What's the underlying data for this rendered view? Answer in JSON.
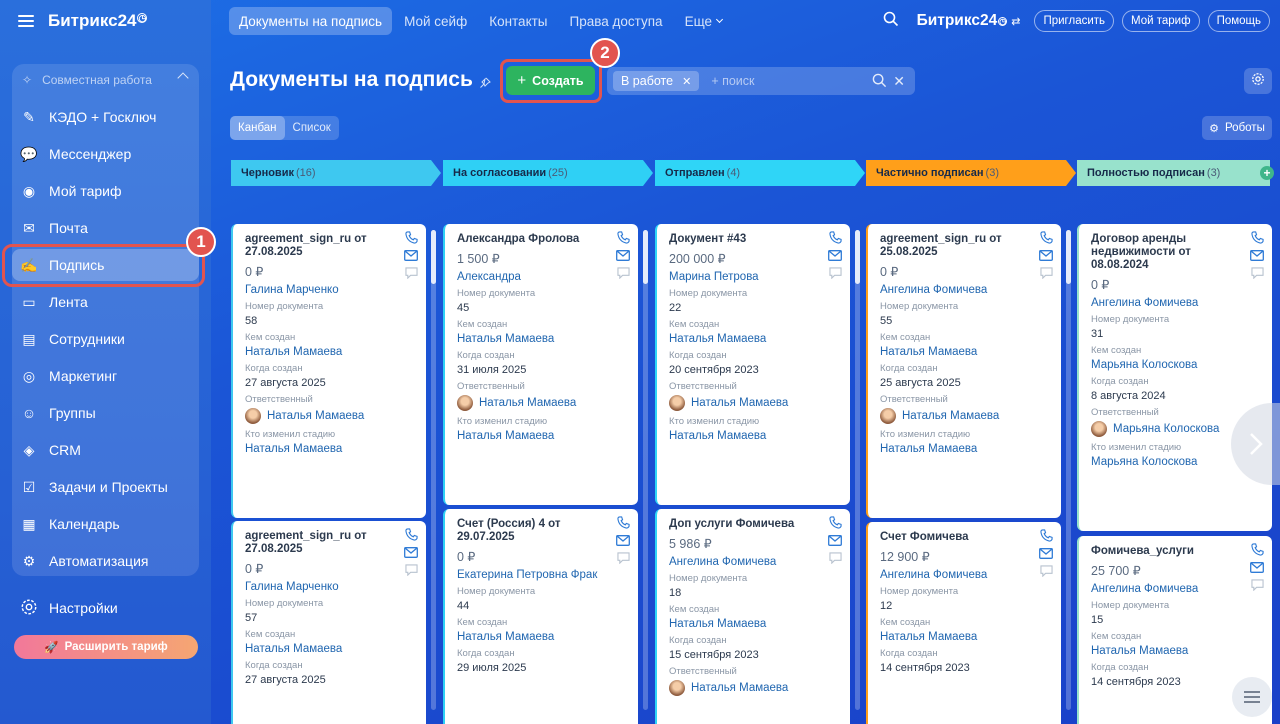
{
  "header": {
    "brand": "Битрикс24",
    "tabs": [
      {
        "label": "Документы на подпись",
        "active": true
      },
      {
        "label": "Мой сейф"
      },
      {
        "label": "Контакты"
      },
      {
        "label": "Права доступа"
      },
      {
        "label": "Еще"
      }
    ],
    "brand_right": "Битрикс24",
    "invite": "Пригласить",
    "my_plan": "Мой тариф",
    "help": "Помощь"
  },
  "sidebar": {
    "section": "Совместная работа",
    "items": [
      {
        "label": "КЭДО + Госключ",
        "icon": "kedo-icon"
      },
      {
        "label": "Мессенджер",
        "icon": "chat-icon"
      },
      {
        "label": "Мой тариф",
        "icon": "plan-icon"
      },
      {
        "label": "Почта",
        "icon": "mail-icon"
      },
      {
        "label": "Подпись",
        "icon": "signature-icon",
        "active": true
      },
      {
        "label": "Лента",
        "icon": "feed-icon"
      },
      {
        "label": "Сотрудники",
        "icon": "employees-icon"
      },
      {
        "label": "Маркетинг",
        "icon": "marketing-icon"
      },
      {
        "label": "Группы",
        "icon": "groups-icon"
      },
      {
        "label": "CRM",
        "icon": "crm-icon"
      },
      {
        "label": "Задачи и Проекты",
        "icon": "tasks-icon"
      },
      {
        "label": "Календарь",
        "icon": "calendar-icon"
      },
      {
        "label": "Автоматизация",
        "icon": "automation-icon"
      }
    ],
    "settings": "Настройки",
    "upgrade": "Расширить тариф"
  },
  "annotations": {
    "one": "1",
    "two": "2"
  },
  "toolbar": {
    "title": "Документы на подпись",
    "create": "Создать",
    "filter_chip": "В работе",
    "search_placeholder": "+ поиск",
    "view_kanban": "Канбан",
    "view_list": "Список",
    "robots": "Роботы"
  },
  "columns": [
    {
      "name": "Черновик",
      "count": "(16)",
      "color": "#3ec8f0"
    },
    {
      "name": "На согласовании",
      "count": "(25)",
      "color": "#2fd0f5"
    },
    {
      "name": "Отправлен",
      "count": "(4)",
      "color": "#2fd5f7"
    },
    {
      "name": "Частично подписан",
      "count": "(3)",
      "color": "#ff9f1a"
    },
    {
      "name": "Полностью подписан",
      "count": "(3)",
      "color": "#98e2cc"
    }
  ],
  "labels": {
    "doc_number": "Номер документа",
    "created_by": "Кем создан",
    "created_when": "Когда создан",
    "responsible": "Ответственный",
    "stage_changed": "Кто изменил стадию"
  },
  "cards": [
    [
      {
        "title": "agreement_sign_ru от 27.08.2025",
        "amount": "0 ₽",
        "contact": "Галина Марченко",
        "number": "58",
        "creator": "Наталья Мамаева",
        "created": "27 августа 2025",
        "responsible": "Наталья Мамаева",
        "stage_by": "Наталья Мамаева"
      },
      {
        "title": "agreement_sign_ru от 27.08.2025",
        "amount": "0 ₽",
        "contact": "Галина Марченко",
        "number": "57",
        "creator": "Наталья Мамаева",
        "created": "27 августа 2025",
        "responsible": "",
        "stage_by": ""
      }
    ],
    [
      {
        "title": "Александра Фролова",
        "amount": "1 500 ₽",
        "contact": "Александра",
        "number": "45",
        "creator": "Наталья Мамаева",
        "created": "31 июля 2025",
        "responsible": "Наталья Мамаева",
        "stage_by": "Наталья Мамаева"
      },
      {
        "title": "Счет (Россия) 4 от 29.07.2025",
        "amount": "0 ₽",
        "contact": "Екатерина Петровна Фрак",
        "number": "44",
        "creator": "Наталья Мамаева",
        "created": "29 июля 2025",
        "responsible": "",
        "stage_by": ""
      }
    ],
    [
      {
        "title": "Документ #43",
        "amount": "200 000 ₽",
        "contact": "Марина Петрова",
        "number": "22",
        "creator": "Наталья Мамаева",
        "created": "20 сентября 2023",
        "responsible": "Наталья Мамаева",
        "stage_by": "Наталья Мамаева"
      },
      {
        "title": "Доп услуги Фомичева",
        "amount": "5 986 ₽",
        "contact": "Ангелина Фомичева",
        "number": "18",
        "creator": "Наталья Мамаева",
        "created": "15 сентября 2023",
        "responsible": "Наталья Мамаева",
        "stage_by": ""
      }
    ],
    [
      {
        "title": "agreement_sign_ru от 25.08.2025",
        "amount": "0 ₽",
        "contact": "Ангелина Фомичева",
        "number": "55",
        "creator": "Наталья Мамаева",
        "created": "25 августа 2025",
        "responsible": "Наталья Мамаева",
        "stage_by": "Наталья Мамаева"
      },
      {
        "title": "Счет Фомичева",
        "amount": "12 900 ₽",
        "contact": "Ангелина Фомичева",
        "number": "12",
        "creator": "Наталья Мамаева",
        "created": "14 сентября 2023",
        "responsible": "",
        "stage_by": ""
      }
    ],
    [
      {
        "title": "Договор аренды недвижимости от 08.08.2024",
        "amount": "0 ₽",
        "contact": "Ангелина Фомичева",
        "number": "31",
        "creator": "Марьяна Колоскова",
        "created": "8 августа 2024",
        "responsible": "Марьяна Колоскова",
        "stage_by": "Марьяна Колоскова"
      },
      {
        "title": "Фомичева_услуги",
        "amount": "25 700 ₽",
        "contact": "Ангелина Фомичева",
        "number": "15",
        "creator": "Наталья Мамаева",
        "created": "14 сентября 2023",
        "responsible": "",
        "stage_by": ""
      }
    ]
  ]
}
